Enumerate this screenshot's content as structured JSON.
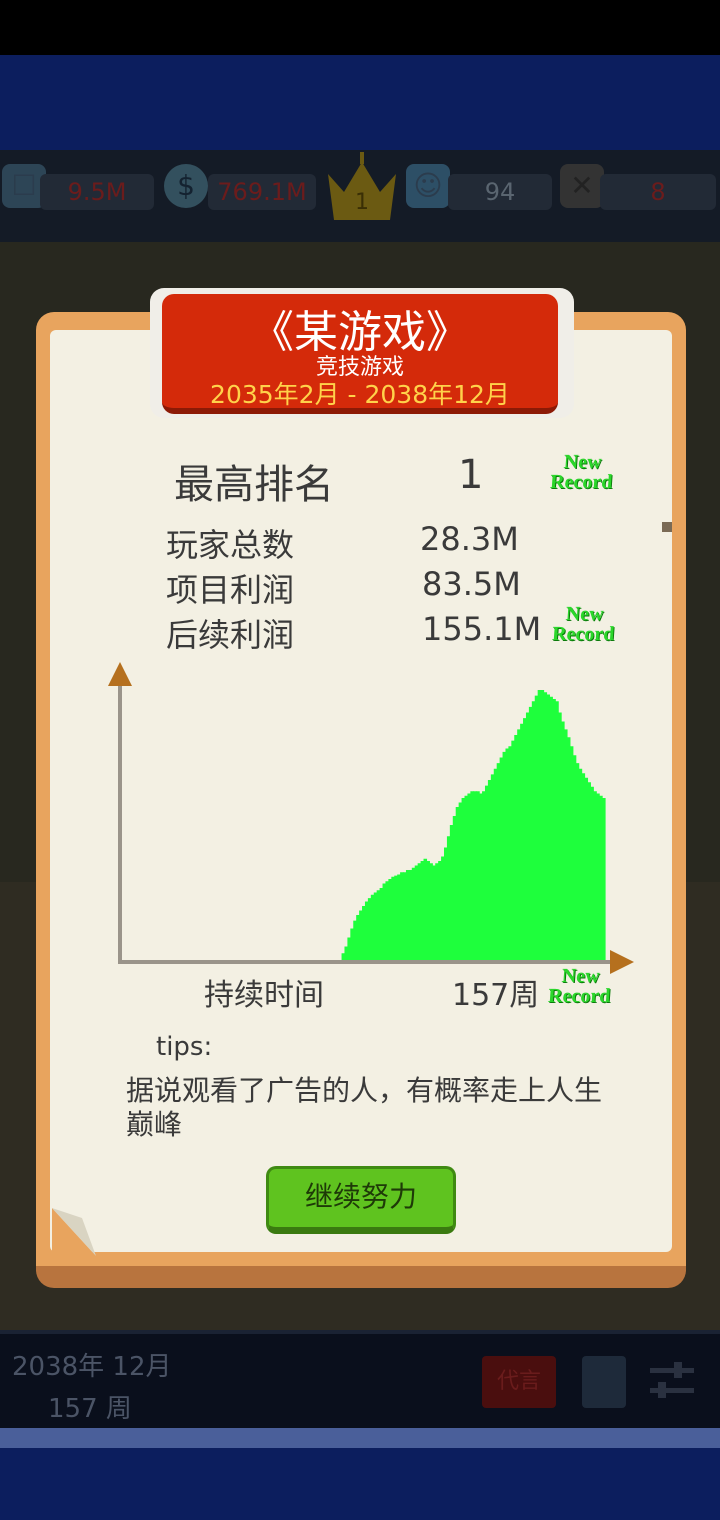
{
  "stats": {
    "team": "9.5M",
    "money": "769.1M",
    "rank": "1",
    "fans": "94",
    "bugs": "8"
  },
  "dialog": {
    "title": "《某游戏》",
    "genre": "竞技游戏",
    "dates": "2035年2月 - 2038年12月",
    "rank_label": "最高排名",
    "rank_value": "1",
    "players_label": "玩家总数",
    "players_value": "28.3M",
    "profit_label": "项目利润",
    "profit_value": "83.5M",
    "seq_profit_label": "后续利润",
    "seq_profit_value": "155.1M",
    "new_record_line1": "New",
    "new_record_line2": "Record",
    "x_label": "持续时间",
    "x_value": "157周",
    "tips_label": "tips:",
    "tips_text": "据说观看了广告的人，有概率走上人生巅峰",
    "continue_label": "继续努力"
  },
  "bottom": {
    "date_ym": "2038年 12月",
    "date_week": "157 周",
    "ad_label": "代言"
  },
  "chart_data": {
    "type": "area",
    "x_label": "持续时间",
    "x_max_label": "157周",
    "color": "#1eff3c",
    "values": [
      0,
      0,
      0,
      0,
      0,
      0,
      0,
      0,
      0,
      0,
      0,
      0,
      0,
      0,
      0,
      0,
      0,
      0,
      0,
      0,
      0,
      0,
      0,
      0,
      0,
      0,
      0,
      0,
      0,
      0,
      0,
      0,
      0,
      0,
      0,
      0,
      0,
      0,
      0,
      0,
      0,
      0,
      0,
      0,
      0,
      0,
      0,
      0,
      0,
      0,
      0,
      0,
      0,
      0,
      0,
      0,
      0,
      0,
      0,
      0,
      0,
      0,
      0,
      0,
      0,
      0,
      0,
      0,
      0,
      0,
      0,
      0,
      0,
      0,
      0,
      6,
      12,
      20,
      28,
      35,
      40,
      44,
      48,
      52,
      55,
      58,
      60,
      62,
      64,
      68,
      70,
      72,
      74,
      75,
      76,
      78,
      78,
      80,
      80,
      82,
      84,
      86,
      88,
      90,
      88,
      86,
      84,
      86,
      88,
      92,
      100,
      110,
      120,
      128,
      136,
      140,
      144,
      146,
      148,
      150,
      150,
      150,
      148,
      150,
      155,
      160,
      165,
      170,
      175,
      180,
      185,
      188,
      190,
      195,
      200,
      205,
      210,
      215,
      220,
      225,
      230,
      235,
      240,
      240,
      238,
      236,
      234,
      232,
      230,
      220,
      212,
      205,
      198,
      190,
      182,
      175,
      170,
      166,
      162,
      158,
      154,
      150,
      148,
      146,
      144
    ]
  }
}
